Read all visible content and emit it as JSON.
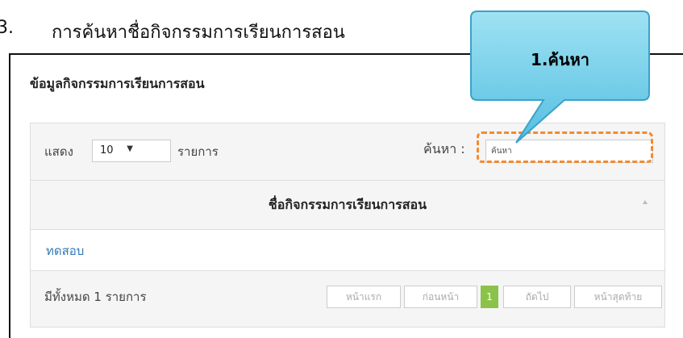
{
  "document": {
    "section_number": "3.",
    "section_title": "การค้นหาชื่อกิจกรรมการเรียนการสอน"
  },
  "panel": {
    "title": "ข้อมูลกิจกรรมการเรียนการสอน"
  },
  "toolbar": {
    "show_label": "แสดง",
    "page_size": "10",
    "records_label": "รายการ",
    "search_label": "ค้นหา :",
    "search_placeholder": "ค้นหา"
  },
  "table": {
    "column_header": "ชื่อกิจกรรมการเรียนการสอน",
    "rows": [
      {
        "name": "ทดสอบ"
      }
    ],
    "total_text": "มีทั้งหมด 1 รายการ"
  },
  "pagination": {
    "first_label": "หน้าแรก",
    "previous_label": "ก่อนหน้า",
    "current_page": "1",
    "next_label": "ถัดไป",
    "last_label": "หน้าสุดท้าย"
  },
  "annotation": {
    "callout_label": "1.ค้นหา",
    "callout_color": "#6ccfea",
    "highlight_color": "#f28b2f"
  },
  "colors": {
    "link": "#337ab7",
    "active_page": "#8bc34a"
  }
}
